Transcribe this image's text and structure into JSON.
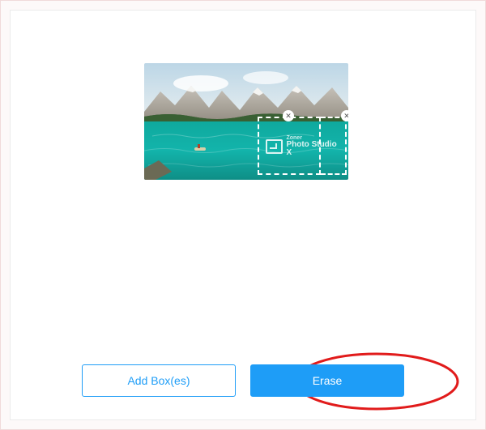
{
  "buttons": {
    "add_box_label": "Add Box(es)",
    "erase_label": "Erase"
  },
  "selection": {
    "close_glyph": "✕"
  },
  "watermark": {
    "line1": "Zoner",
    "line2_a": "Photo",
    "line2_b": "Studio",
    "line2_c": "X"
  },
  "colors": {
    "accent": "#1e9df7",
    "callout": "#e11b1b"
  }
}
